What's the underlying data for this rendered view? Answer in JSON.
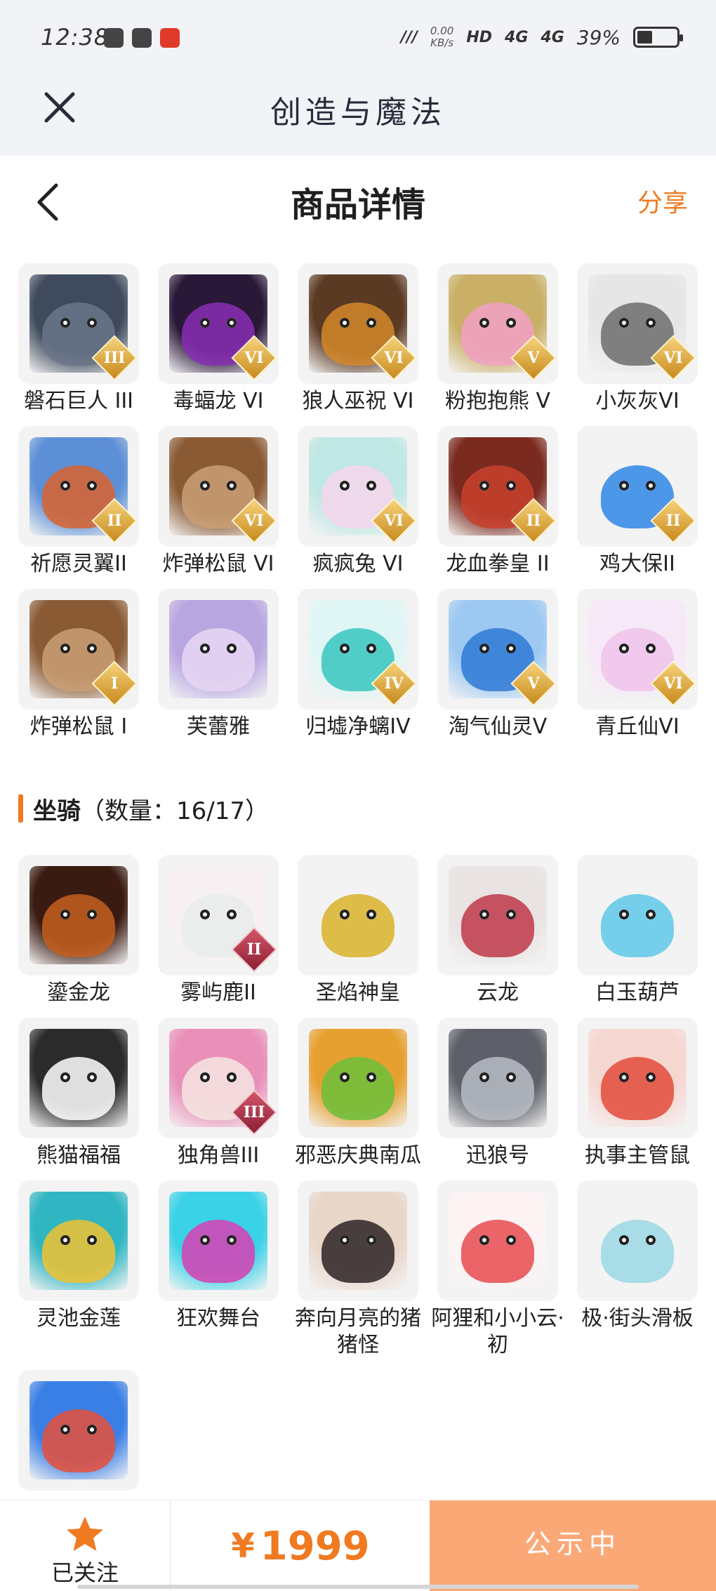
{
  "status_bar": {
    "time": "12:38",
    "speed_value": "0.00",
    "speed_unit": "KB/s",
    "hd": "HD",
    "net1": "4G",
    "net2": "4G",
    "battery_percent_text": "39%",
    "battery_level": 0.39
  },
  "app_header": {
    "title": "创造与魔法"
  },
  "page_nav": {
    "title": "商品详情",
    "share_label": "分享"
  },
  "pets": [
    {
      "name": "磐石巨人 III",
      "badge": "III",
      "color": "#6a7688",
      "bg": "#3f4b5c",
      "badge_style": "gold"
    },
    {
      "name": "毒蝠龙 VI",
      "badge": "VI",
      "color": "#8a2fb5",
      "bg": "#2a1838",
      "badge_style": "gold"
    },
    {
      "name": "狼人巫祝 VI",
      "badge": "VI",
      "color": "#d4882a",
      "bg": "#5b3a24",
      "badge_style": "gold"
    },
    {
      "name": "粉抱抱熊 V",
      "badge": "V",
      "color": "#f2a0c6",
      "bg": "#c9b066",
      "badge_style": "gold"
    },
    {
      "name": "小灰灰VI",
      "badge": "VI",
      "color": "#6c6c6c",
      "bg": "#e6e6e6",
      "badge_style": "gold"
    },
    {
      "name": "祈愿灵翼II",
      "badge": "II",
      "color": "#d9632e",
      "bg": "#5c8fd6",
      "badge_style": "gold"
    },
    {
      "name": "炸弹松鼠 VI",
      "badge": "VI",
      "color": "#caa075",
      "bg": "#8a5a34",
      "badge_style": "gold"
    },
    {
      "name": "疯疯兔 VI",
      "badge": "VI",
      "color": "#f6d6ec",
      "bg": "#bfe7e3",
      "badge_style": "gold"
    },
    {
      "name": "龙血拳皇 II",
      "badge": "II",
      "color": "#c9412e",
      "bg": "#7a2a1e",
      "badge_style": "gold"
    },
    {
      "name": "鸡大保II",
      "badge": "II",
      "color": "#2f86e6",
      "bg": "#f3f3f3",
      "badge_style": "gold"
    },
    {
      "name": "炸弹松鼠 I",
      "badge": "I",
      "color": "#caa075",
      "bg": "#8a5a34",
      "badge_style": "gold"
    },
    {
      "name": "芙蕾雅",
      "badge": "",
      "color": "#e7d7f3",
      "bg": "#b8a6e0",
      "badge_style": "none"
    },
    {
      "name": "归墟净螭IV",
      "badge": "IV",
      "color": "#38c6c0",
      "bg": "#dff6f4",
      "badge_style": "gold"
    },
    {
      "name": "淘气仙灵V",
      "badge": "V",
      "color": "#2f7ad6",
      "bg": "#9cc8f2",
      "badge_style": "gold"
    },
    {
      "name": "青丘仙VI",
      "badge": "VI",
      "color": "#efc3ea",
      "bg": "#f6e8f7",
      "badge_style": "gold"
    }
  ],
  "mounts_section": {
    "label": "坐骑",
    "count": "（数量：16/17）"
  },
  "mounts": [
    {
      "name": "鎏金龙",
      "badge": "",
      "color": "#c65f1f",
      "bg": "#3a1b12",
      "badge_style": "none"
    },
    {
      "name": "雾屿鹿II",
      "badge": "II",
      "color": "#e8ece9",
      "bg": "#f6f0f3",
      "badge_style": "red"
    },
    {
      "name": "圣焰神皇",
      "badge": "",
      "color": "#d8b128",
      "bg": "#f3f3f3",
      "badge_style": "none"
    },
    {
      "name": "云龙",
      "badge": "",
      "color": "#c0384a",
      "bg": "#e9e3e3",
      "badge_style": "none"
    },
    {
      "name": "白玉葫芦",
      "badge": "",
      "color": "#5fc8e8",
      "bg": "#f3f3f3",
      "badge_style": "none"
    },
    {
      "name": "熊猫福福",
      "badge": "",
      "color": "#ffffff",
      "bg": "#2b2b2b",
      "badge_style": "none"
    },
    {
      "name": "独角兽III",
      "badge": "III",
      "color": "#f4e6e1",
      "bg": "#e98fb8",
      "badge_style": "red"
    },
    {
      "name": "邪恶庆典南瓜",
      "badge": "",
      "color": "#6bbf3a",
      "bg": "#e6a030",
      "badge_style": "none"
    },
    {
      "name": "迅狼号",
      "badge": "",
      "color": "#b7bcc4",
      "bg": "#5d6068",
      "badge_style": "none"
    },
    {
      "name": "执事主管鼠",
      "badge": "",
      "color": "#e24b3a",
      "bg": "#f6d6d0",
      "badge_style": "none"
    },
    {
      "name": "灵池金莲",
      "badge": "",
      "color": "#f1c230",
      "bg": "#2fb6c2",
      "badge_style": "none"
    },
    {
      "name": "狂欢舞台",
      "badge": "",
      "color": "#d83fb3",
      "bg": "#3ad2e6",
      "badge_style": "none"
    },
    {
      "name": "奔向月亮的猪猪怪",
      "badge": "",
      "color": "#2d2326",
      "bg": "#e8d6c8",
      "badge_style": "none"
    },
    {
      "name": "阿狸和小小云·初",
      "badge": "",
      "color": "#e84a4f",
      "bg": "#fdf3f4",
      "badge_style": "none"
    },
    {
      "name": "极·街头滑板",
      "badge": "",
      "color": "#9ad8e4",
      "bg": "#f3f3f3",
      "badge_style": "none"
    },
    {
      "name": "",
      "badge": "",
      "color": "#e8503a",
      "bg": "#3a7fe6",
      "badge_style": "none"
    }
  ],
  "bottom_bar": {
    "follow_label": "已关注",
    "currency": "¥",
    "price": "1999",
    "action_label": "公示中"
  },
  "colors": {
    "accent": "#f07a21",
    "action_button": "#fba877"
  }
}
